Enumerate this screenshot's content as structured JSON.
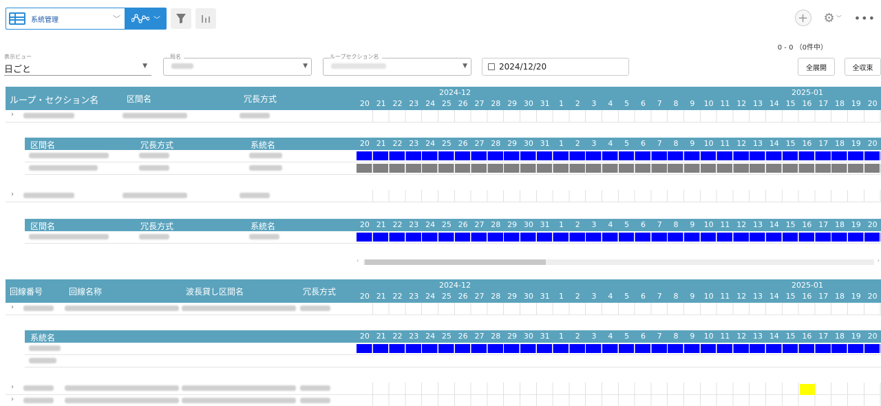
{
  "toolbar": {
    "view_label": "系統管理",
    "view_dropdown_icon": "chevron-down-icon",
    "chart_icon": "line-chart-icon",
    "filter_icon": "funnel-icon",
    "column_icon": "bar-chart-icon"
  },
  "top_right": {
    "add_icon": "plus-icon",
    "settings_icon": "gear-icon",
    "more_label": "•••",
    "count_text": "0 - 0 （0件中）"
  },
  "filters": {
    "view_legend": "表示ビュー",
    "view_value": "日ごと",
    "station_legend": "局名",
    "section_legend": "ループセクション名",
    "date_value": "2024/12/20",
    "expand_all": "全展開",
    "collapse_all": "全収束"
  },
  "gantt1": {
    "columns": [
      "ループ・セクション名",
      "区間名",
      "冗長方式"
    ],
    "months": [
      "2024-12",
      "2025-01"
    ],
    "sub_columns": [
      "区間名",
      "冗長方式",
      "系統名"
    ]
  },
  "gantt2": {
    "columns": [
      "回線番号",
      "回線名称",
      "波長貸し区間名",
      "冗長方式"
    ],
    "months": [
      "2024-12",
      "2025-01"
    ],
    "sub_columns": [
      "系統名"
    ]
  },
  "days": [
    "20",
    "21",
    "22",
    "23",
    "24",
    "25",
    "26",
    "27",
    "28",
    "29",
    "30",
    "31",
    "1",
    "2",
    "3",
    "4",
    "5",
    "6",
    "7",
    "8",
    "9",
    "10",
    "11",
    "12",
    "13",
    "14",
    "15",
    "16",
    "17",
    "18",
    "19",
    "20"
  ],
  "colors": {
    "header": "#5ba3bd",
    "bar_active": "#0000ff",
    "bar_inactive": "#808080",
    "highlight": "#ffff00",
    "accent": "#2a8cd6"
  }
}
